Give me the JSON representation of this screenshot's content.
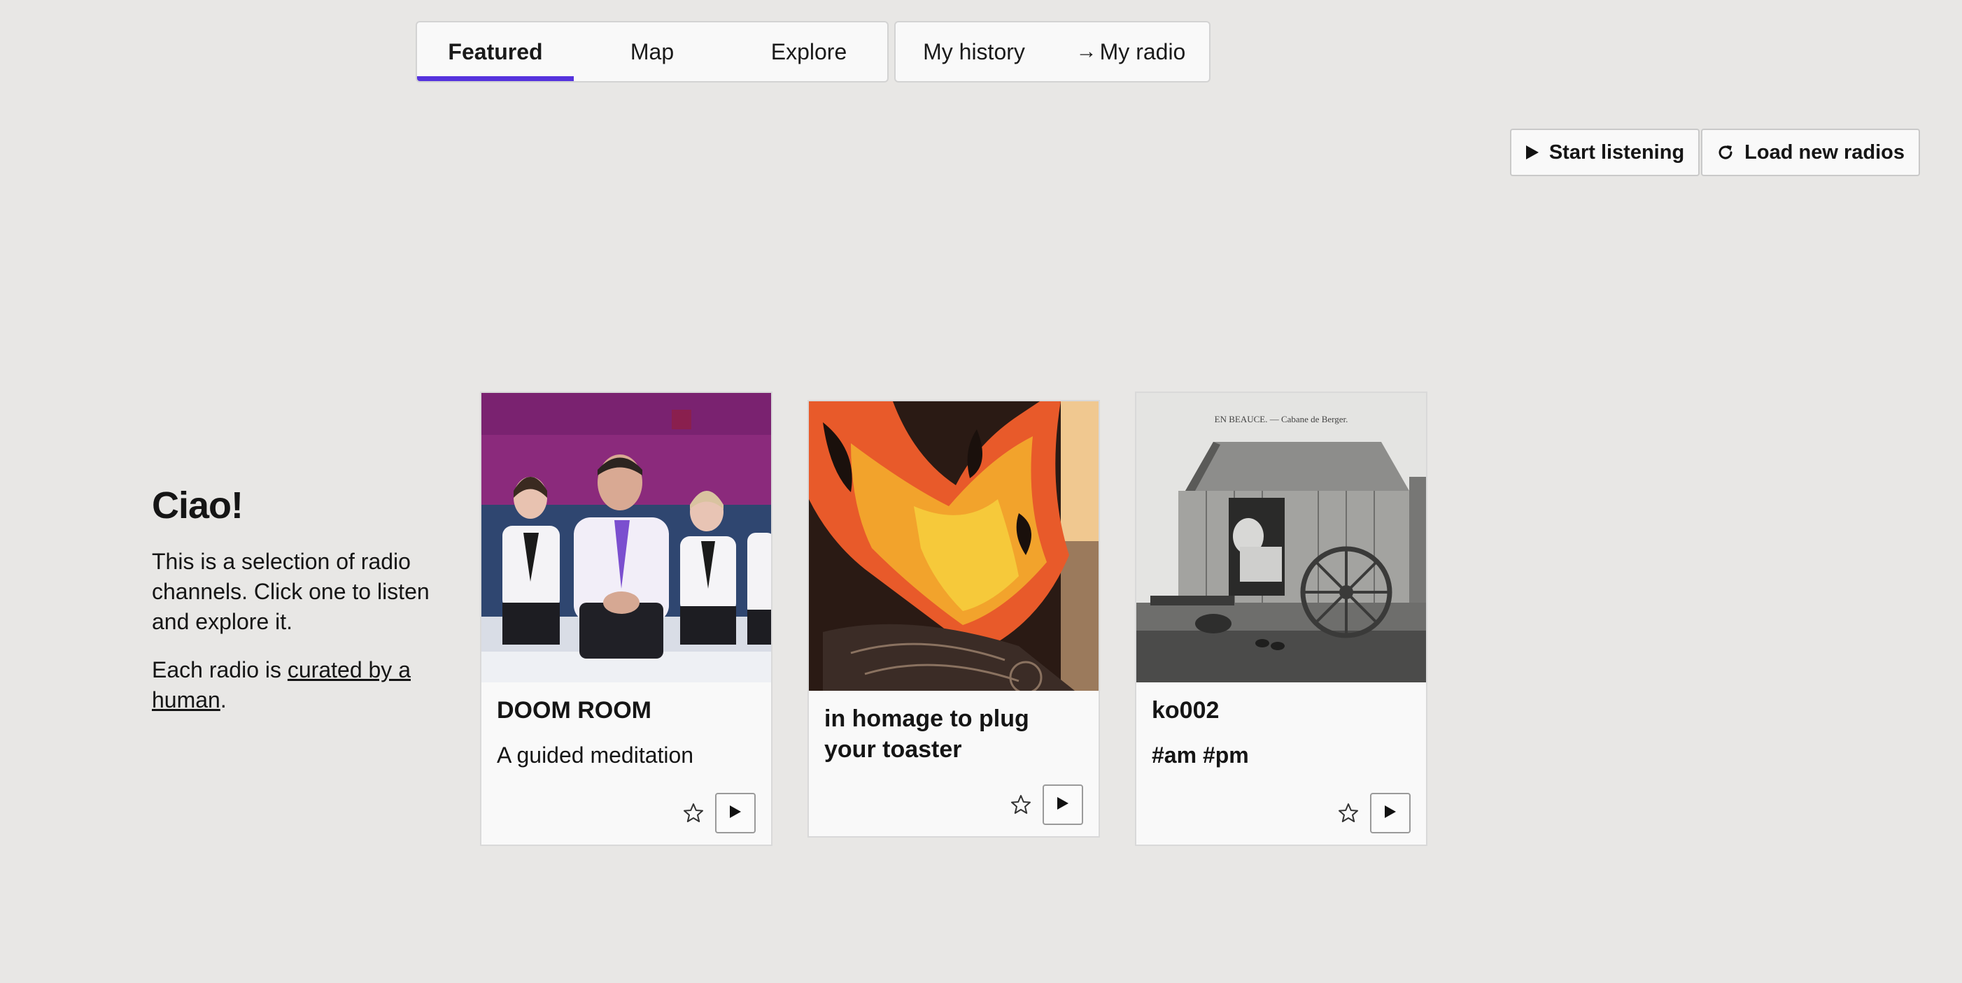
{
  "nav": {
    "primary_tabs": [
      {
        "label": "Featured",
        "active": true
      },
      {
        "label": "Map",
        "active": false
      },
      {
        "label": "Explore",
        "active": false
      }
    ],
    "secondary_tabs": [
      {
        "label": "My history"
      },
      {
        "label": "My radio",
        "icon": "arrow-right-icon"
      }
    ],
    "accent_color": "#5533dd"
  },
  "actions": {
    "start_listening": {
      "label": "Start listening",
      "icon": "play-icon"
    },
    "load_new_radios": {
      "label": "Load new radios",
      "icon": "refresh-icon"
    }
  },
  "intro": {
    "heading": "Ciao!",
    "paragraph1": "This is a selection of radio channels. Click one to listen and explore it.",
    "paragraph2_prefix": "Each radio is ",
    "paragraph2_link": "curated by a human",
    "paragraph2_suffix": "."
  },
  "cards": [
    {
      "title": "DOOM ROOM",
      "description": "A guided meditation",
      "image": "doom-room-artwork",
      "favorite_icon": "star-icon",
      "play_icon": "play-icon"
    },
    {
      "title": "in homage to plug your toaster",
      "description": "",
      "image": "plug-your-toaster-artwork",
      "favorite_icon": "star-icon",
      "play_icon": "play-icon"
    },
    {
      "title": "ko002",
      "description": "#am #pm",
      "image": "shepherd-cabin-photo",
      "favorite_icon": "star-icon",
      "play_icon": "play-icon"
    }
  ],
  "card3_postcard_caption": "EN BEAUCE. — Cabane de Berger."
}
